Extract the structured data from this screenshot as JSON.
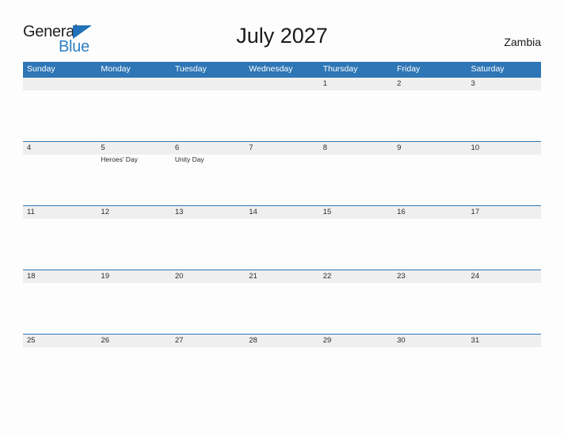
{
  "brand": {
    "line1": "General",
    "line2": "Blue",
    "triangle_color": "#1f72b8",
    "text_color_line1": "#231f20",
    "text_color_line2": "#2f7fc4"
  },
  "header": {
    "title": "July 2027",
    "country": "Zambia"
  },
  "colors": {
    "header_blue": "#2e76b6",
    "date_band_gray": "#efefef",
    "page_background": "#fdfdfd",
    "text_dark": "#2b2b2b"
  },
  "calendar": {
    "weekdays": [
      "Sunday",
      "Monday",
      "Tuesday",
      "Wednesday",
      "Thursday",
      "Friday",
      "Saturday"
    ],
    "weeks": [
      {
        "days": [
          {
            "date": "",
            "events": []
          },
          {
            "date": "",
            "events": []
          },
          {
            "date": "",
            "events": []
          },
          {
            "date": "",
            "events": []
          },
          {
            "date": "1",
            "events": []
          },
          {
            "date": "2",
            "events": []
          },
          {
            "date": "3",
            "events": []
          }
        ]
      },
      {
        "days": [
          {
            "date": "4",
            "events": []
          },
          {
            "date": "5",
            "events": [
              "Heroes' Day"
            ]
          },
          {
            "date": "6",
            "events": [
              "Unity Day"
            ]
          },
          {
            "date": "7",
            "events": []
          },
          {
            "date": "8",
            "events": []
          },
          {
            "date": "9",
            "events": []
          },
          {
            "date": "10",
            "events": []
          }
        ]
      },
      {
        "days": [
          {
            "date": "11",
            "events": []
          },
          {
            "date": "12",
            "events": []
          },
          {
            "date": "13",
            "events": []
          },
          {
            "date": "14",
            "events": []
          },
          {
            "date": "15",
            "events": []
          },
          {
            "date": "16",
            "events": []
          },
          {
            "date": "17",
            "events": []
          }
        ]
      },
      {
        "days": [
          {
            "date": "18",
            "events": []
          },
          {
            "date": "19",
            "events": []
          },
          {
            "date": "20",
            "events": []
          },
          {
            "date": "21",
            "events": []
          },
          {
            "date": "22",
            "events": []
          },
          {
            "date": "23",
            "events": []
          },
          {
            "date": "24",
            "events": []
          }
        ]
      },
      {
        "days": [
          {
            "date": "25",
            "events": []
          },
          {
            "date": "26",
            "events": []
          },
          {
            "date": "27",
            "events": []
          },
          {
            "date": "28",
            "events": []
          },
          {
            "date": "29",
            "events": []
          },
          {
            "date": "30",
            "events": []
          },
          {
            "date": "31",
            "events": []
          }
        ]
      }
    ]
  }
}
